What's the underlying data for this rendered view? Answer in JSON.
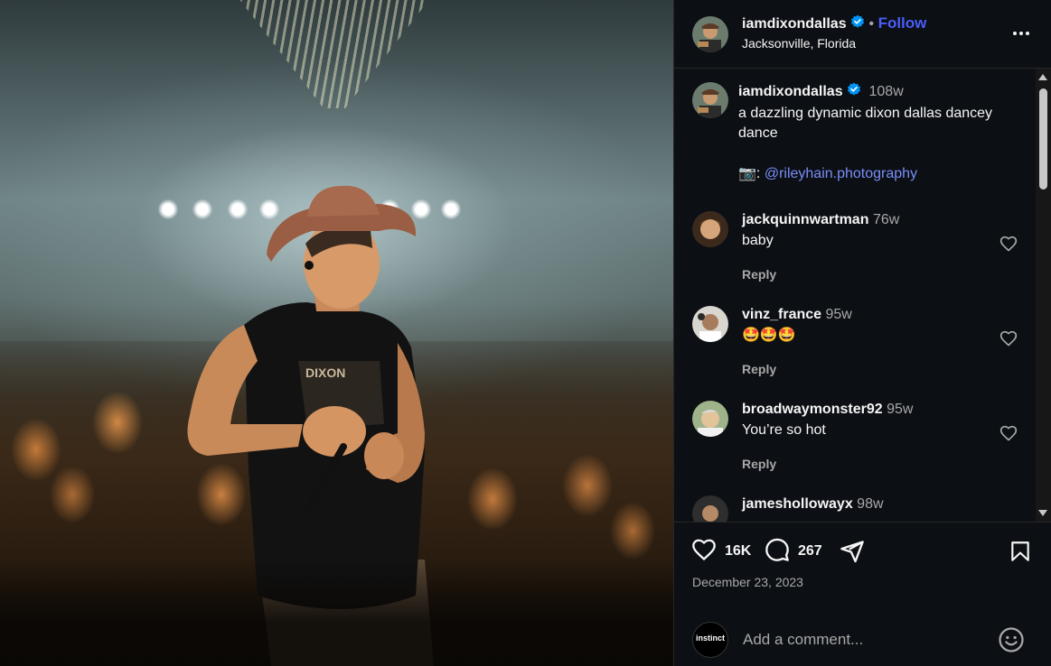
{
  "post": {
    "author": "iamdixondallas",
    "location": "Jacksonville, Florida",
    "follow_label": "Follow",
    "more_label": "•••",
    "date": "December 23, 2023"
  },
  "caption": {
    "author": "iamdixondallas",
    "time": "108w",
    "text": "a dazzling dynamic dixon dallas dancey dance",
    "credit_prefix": "📷:",
    "credit_mention": "@rileyhain.photography"
  },
  "comments": [
    {
      "user": "jackquinnwartman",
      "time": "76w",
      "text": "baby",
      "reply": "Reply"
    },
    {
      "user": "vinz_france",
      "time": "95w",
      "text": "🤩🤩🤩",
      "reply": "Reply"
    },
    {
      "user": "broadwaymonster92",
      "time": "95w",
      "text": "You’re so hot",
      "reply": "Reply"
    },
    {
      "user": "jameshollowayx",
      "time": "98w",
      "text": "",
      "reply": ""
    }
  ],
  "stats": {
    "likes": "16K",
    "comments": "267"
  },
  "composer": {
    "avatar_text": "instinct",
    "placeholder": "Add a comment..."
  },
  "colors": {
    "link": "#4a5df9",
    "verified": "#0095f6",
    "panel_bg": "#0c0f14"
  }
}
